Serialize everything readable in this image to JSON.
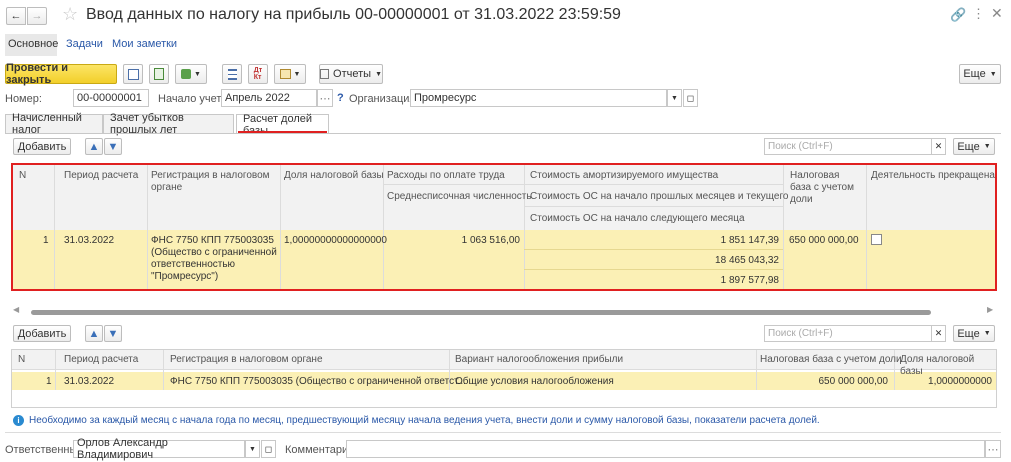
{
  "title": "Ввод данных по налогу на прибыль 00-00000001 от 31.03.2022 23:59:59",
  "nav_tabs": [
    "Основное",
    "Задачи",
    "Мои заметки"
  ],
  "toolbar": {
    "post_close": "Провести и закрыть",
    "reports": "Отчеты",
    "more": "Еще"
  },
  "fields": {
    "number_label": "Номер:",
    "number_value": "00-00000001",
    "start_label": "Начало учета:",
    "start_value": "Апрель 2022",
    "help": "?",
    "org_label": "Организация:",
    "org_value": "Промресурс"
  },
  "tabs": [
    "Начисленный налог",
    "Зачет убытков прошлых лет",
    "Расчет долей базы"
  ],
  "table1": {
    "add": "Добавить",
    "search_placeholder": "Поиск (Ctrl+F)",
    "more": "Еще",
    "headers": {
      "n": "N",
      "period": "Период расчета",
      "reg": "Регистрация в налоговом органе",
      "share": "Доля налоговой базы",
      "labor": "Расходы по оплате труда",
      "headcount": "Среднесписочная численность",
      "assets": "Стоимость амортизируемого имущества",
      "os_start": "Стоимость ОС на начало прошлых месяцев и текущего",
      "os_next": "Стоимость ОС на начало следующего месяца",
      "base": "Налоговая база с учетом доли",
      "stopped": "Деятельность прекращена"
    },
    "row": {
      "n": "1",
      "period": "31.03.2022",
      "reg": "ФНС 7750 КПП 775003035 (Общество с ограниченной ответственностью \"Промресурс\")",
      "share": "1,00000000000000000",
      "labor": "1 063 516,00",
      "assets": "1 851 147,39",
      "os_start": "18 465 043,32",
      "os_next": "1 897 577,98",
      "base": "650 000 000,00"
    }
  },
  "table2": {
    "add": "Добавить",
    "search_placeholder": "Поиск (Ctrl+F)",
    "more": "Еще",
    "headers": [
      "N",
      "Период расчета",
      "Регистрация в налоговом органе",
      "Вариант налогообложения прибыли",
      "Налоговая база с учетом доли",
      "Доля налоговой базы"
    ],
    "row": [
      "1",
      "31.03.2022",
      "ФНС 7750 КПП 775003035 (Общество с ограниченной ответст...",
      "Общие условия налогообложения",
      "650 000 000,00",
      "1,0000000000"
    ]
  },
  "info": "Необходимо за каждый месяц с начала года по месяц, предшествующий месяцу начала ведения учета, внести доли и сумму налоговой базы, показатели расчета долей.",
  "footer": {
    "resp_label": "Ответственный:",
    "resp_value": "Орлов Александр Владимирович",
    "comment_label": "Комментарий:"
  },
  "colors": {
    "accent": "#f5d33b",
    "row_highlight": "#fbf0b5",
    "frame": "#e02020",
    "link": "#2a58a8"
  }
}
